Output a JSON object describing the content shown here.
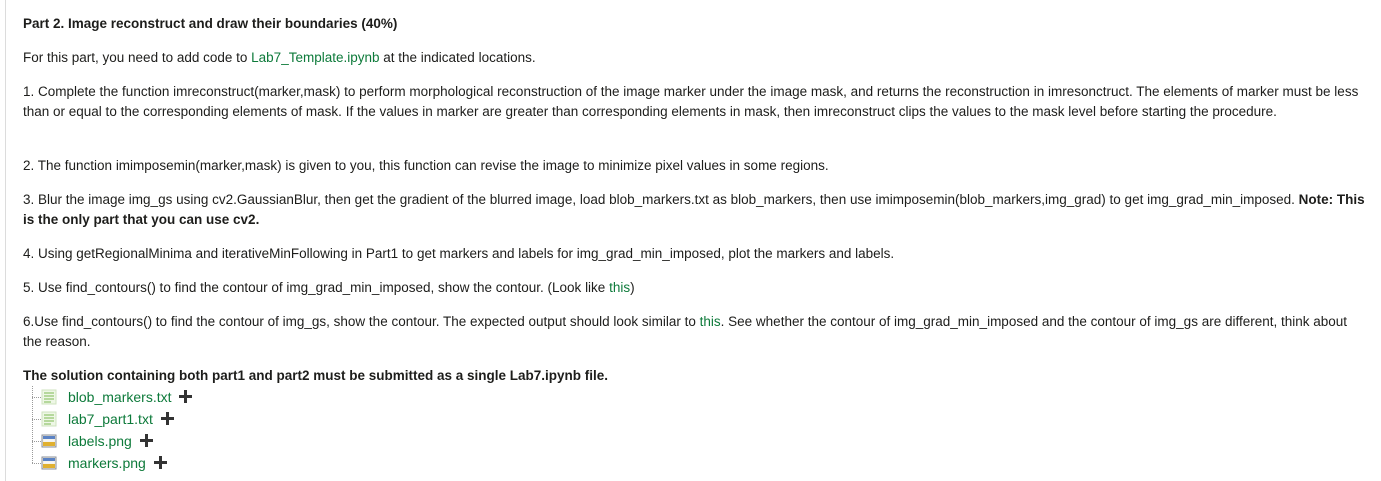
{
  "title": "Part 2. Image reconstruct and draw their boundaries (40%)",
  "intro": {
    "before": "For this part, you need to add code to ",
    "link": "Lab7_Template.ipynb",
    "after": " at the indicated locations."
  },
  "steps": {
    "s1": "1. Complete the function imreconstruct(marker,mask) to perform morphological reconstruction of the image marker under the image mask, and returns the reconstruction in imresonctruct. The elements of marker must be less than or equal to the corresponding elements of mask. If the values in marker are greater than corresponding elements in mask, then imreconstruct clips the values to the mask level before starting the procedure.",
    "s2": "2. The function imimposemin(marker,mask) is given to you, this function can revise the image to minimize pixel values in some regions.",
    "s3_text": "3. Blur the image img_gs using cv2.GaussianBlur, then get the gradient of the blurred image, load blob_markers.txt as blob_markers, then use imimposemin(blob_markers,img_grad) to get img_grad_min_imposed. ",
    "s3_note": "Note: This is the only part that you can use cv2.",
    "s4": "4. Using getRegionalMinima and iterativeMinFollowing in Part1 to get markers and labels for img_grad_min_imposed, plot the markers and labels.",
    "s5_text": "5. Use find_contours() to find the contour of img_grad_min_imposed, show the contour. (Look like ",
    "s5_link": "this",
    "s5_end": ")",
    "s6_text": "6.Use find_contours() to find the contour of img_gs, show the contour. The expected output should look similar to ",
    "s6_link": "this",
    "s6_rest": ". See whether the contour of  img_grad_min_imposed and the contour of img_gs are different, think about the reason."
  },
  "submission_note": "The solution containing both part1 and part2 must be submitted as a single Lab7.ipynb file.",
  "files": [
    {
      "name": "blob_markers.txt",
      "icon": "text-file-icon"
    },
    {
      "name": "lab7_part1.txt",
      "icon": "text-file-icon"
    },
    {
      "name": "labels.png",
      "icon": "image-file-icon"
    },
    {
      "name": "markers.png",
      "icon": "image-file-icon"
    }
  ],
  "colors": {
    "link": "#0d7a3a",
    "text": "#1d1d1b"
  }
}
